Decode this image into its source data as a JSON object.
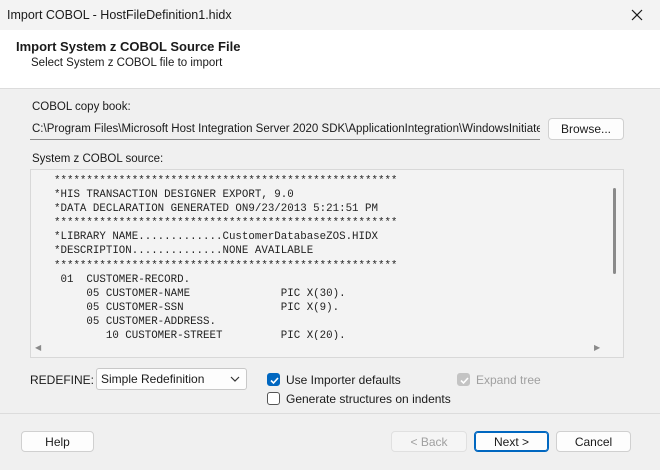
{
  "window": {
    "title": "Import COBOL - HostFileDefinition1.hidx",
    "close_icon": "close-icon"
  },
  "header": {
    "title": "Import System z COBOL Source File",
    "subtitle": "Select System z COBOL file to import"
  },
  "copybook": {
    "label": "COBOL copy book:",
    "value": "C:\\Program Files\\Microsoft Host Integration Server 2020 SDK\\ApplicationIntegration\\WindowsInitiated\\zOS",
    "browse_label": "Browse..."
  },
  "source": {
    "label": "System z COBOL source:",
    "lines": [
      "*****************************************************",
      "*HIS TRANSACTION DESIGNER EXPORT, 9.0",
      "*DATA DECLARATION GENERATED ON9/23/2013 5:21:51 PM",
      "*****************************************************",
      "*LIBRARY NAME.............CustomerDatabaseZOS.HIDX",
      "*DESCRIPTION..............NONE AVAILABLE",
      "*****************************************************",
      " 01  CUSTOMER-RECORD.",
      "     05 CUSTOMER-NAME              PIC X(30).",
      "     05 CUSTOMER-SSN               PIC X(9).",
      "     05 CUSTOMER-ADDRESS.",
      "        10 CUSTOMER-STREET         PIC X(20)."
    ]
  },
  "options": {
    "redefine_label": "REDEFINE:",
    "redefine_value": "Simple Redefinition",
    "use_importer_defaults": {
      "label": "Use Importer defaults",
      "checked": true
    },
    "expand_tree": {
      "label": "Expand tree",
      "checked": true,
      "enabled": false
    },
    "generate_structures": {
      "label": "Generate structures on indents",
      "checked": false
    }
  },
  "footer": {
    "help": "Help",
    "back": "< Back",
    "next": "Next >",
    "cancel": "Cancel"
  },
  "colors": {
    "accent": "#0067c0",
    "dialog_bg": "#f0f0f0",
    "header_bg": "#ffffff"
  }
}
